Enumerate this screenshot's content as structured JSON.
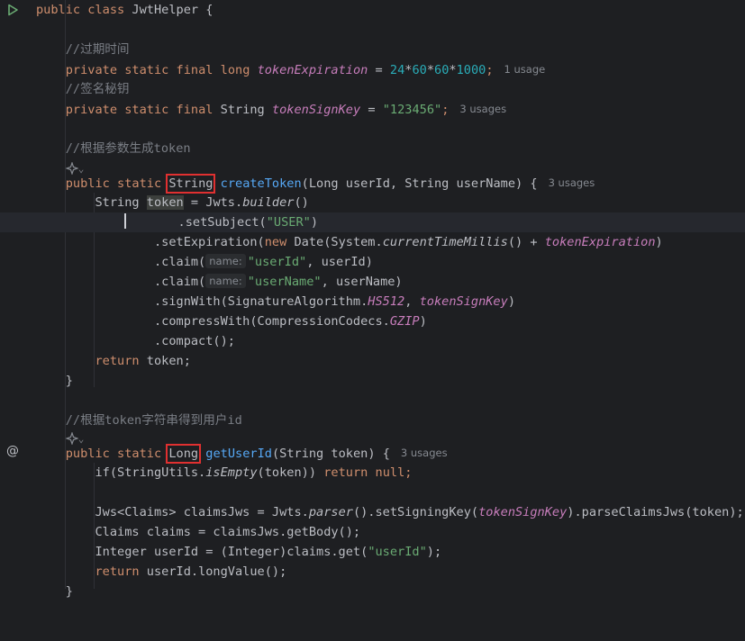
{
  "editor": {
    "theme": {
      "background": "#1e1f22",
      "keyword": "#cf8e6d",
      "string": "#6aab73",
      "number": "#2aacb8",
      "comment": "#7a7e85",
      "function": "#56a8f5",
      "field": "#c77dbb",
      "highlight_box": "#e03030"
    },
    "gutter_icons": [
      {
        "icon": "run-icon",
        "color": "#6aab73"
      },
      {
        "icon": "lightbulb-icon",
        "color": "#f2c55c"
      },
      {
        "icon": "at-implementation-icon",
        "color": "#bcbec4"
      }
    ],
    "ai_hint_icon": "ai-suggestion-icon",
    "code": {
      "l1": {
        "t1": "public",
        "t2": "class",
        "t3": "JwtHelper {"
      },
      "l3": {
        "comment": "//过期时间"
      },
      "l4": {
        "t1": "private",
        "t2": "static",
        "t3": "final",
        "t4": "long",
        "field": "tokenExpiration",
        "t5": " = ",
        "n1": "24",
        "t6": "*",
        "n2": "60",
        "t7": "*",
        "n3": "60",
        "t8": "*",
        "n4": "1000",
        "t9": ";",
        "usage": "1 usage"
      },
      "l5": {
        "comment": "//签名秘钥"
      },
      "l6": {
        "t1": "private",
        "t2": "static",
        "t3": "final",
        "t4": "String",
        "field": "tokenSignKey",
        "t5": " = ",
        "str": "\"123456\"",
        "t6": ";",
        "usage": "3 usages"
      },
      "l8": {
        "comment": "//根据参数生成token"
      },
      "l9": {
        "chevron": "⌄"
      },
      "l10": {
        "t1": "public",
        "t2": "static",
        "type": "String",
        "method": "createToken",
        "params": "(Long userId, String userName) {",
        "usage": "3 usages"
      },
      "l11": {
        "t1": "String ",
        "var": "token",
        "t2": " = Jwts.",
        "static": "builder",
        "t3": "()"
      },
      "l12": {
        "t1": ".setSubject(",
        "str": "\"USER\"",
        "t2": ")"
      },
      "l13": {
        "t1": ".setExpiration(",
        "kw": "new",
        "t2": " Date(System.",
        "static": "currentTimeMillis",
        "t3": "() + ",
        "field": "tokenExpiration",
        "t4": ")"
      },
      "l14": {
        "t1": ".claim(",
        "hint": "name:",
        "str": "\"userId\"",
        "t2": ", userId)"
      },
      "l15": {
        "t1": ".claim(",
        "hint": "name:",
        "str": "\"userName\"",
        "t2": ", userName)"
      },
      "l16": {
        "t1": ".signWith(SignatureAlgorithm.",
        "const": "HS512",
        "t2": ", ",
        "field": "tokenSignKey",
        "t3": ")"
      },
      "l17": {
        "t1": ".compressWith(CompressionCodecs.",
        "const": "GZIP",
        "t2": ")"
      },
      "l18": {
        "t1": ".compact();"
      },
      "l19": {
        "kw": "return",
        "t1": " token;"
      },
      "l20": {
        "t1": "}"
      },
      "l22": {
        "comment": "//根据token字符串得到用户id"
      },
      "l23": {
        "chevron": "⌄"
      },
      "l24": {
        "t1": "public",
        "t2": "static",
        "type": "Long",
        "method": "getUserId",
        "params": "(String token) {",
        "usage": "3 usages"
      },
      "l25": {
        "t1": "if(StringUtils.",
        "static": "isEmpty",
        "t2": "(token)) ",
        "kw1": "return",
        "t3": " ",
        "kw2": "null",
        "t4": ";"
      },
      "l27": {
        "t1": "Jws<Claims> claimsJws = Jwts.",
        "static": "parser",
        "t2": "().setSigningKey(",
        "field": "tokenSignKey",
        "t3": ").parseClaimsJws(token);"
      },
      "l28": {
        "t1": "Claims claims = claimsJws.getBody();"
      },
      "l29": {
        "t1": "Integer userId = (Integer)claims.get(",
        "str": "\"userId\"",
        "t2": ");"
      },
      "l30": {
        "kw": "return",
        "t1": " userId.longValue();"
      },
      "l31": {
        "t1": "}"
      }
    }
  }
}
